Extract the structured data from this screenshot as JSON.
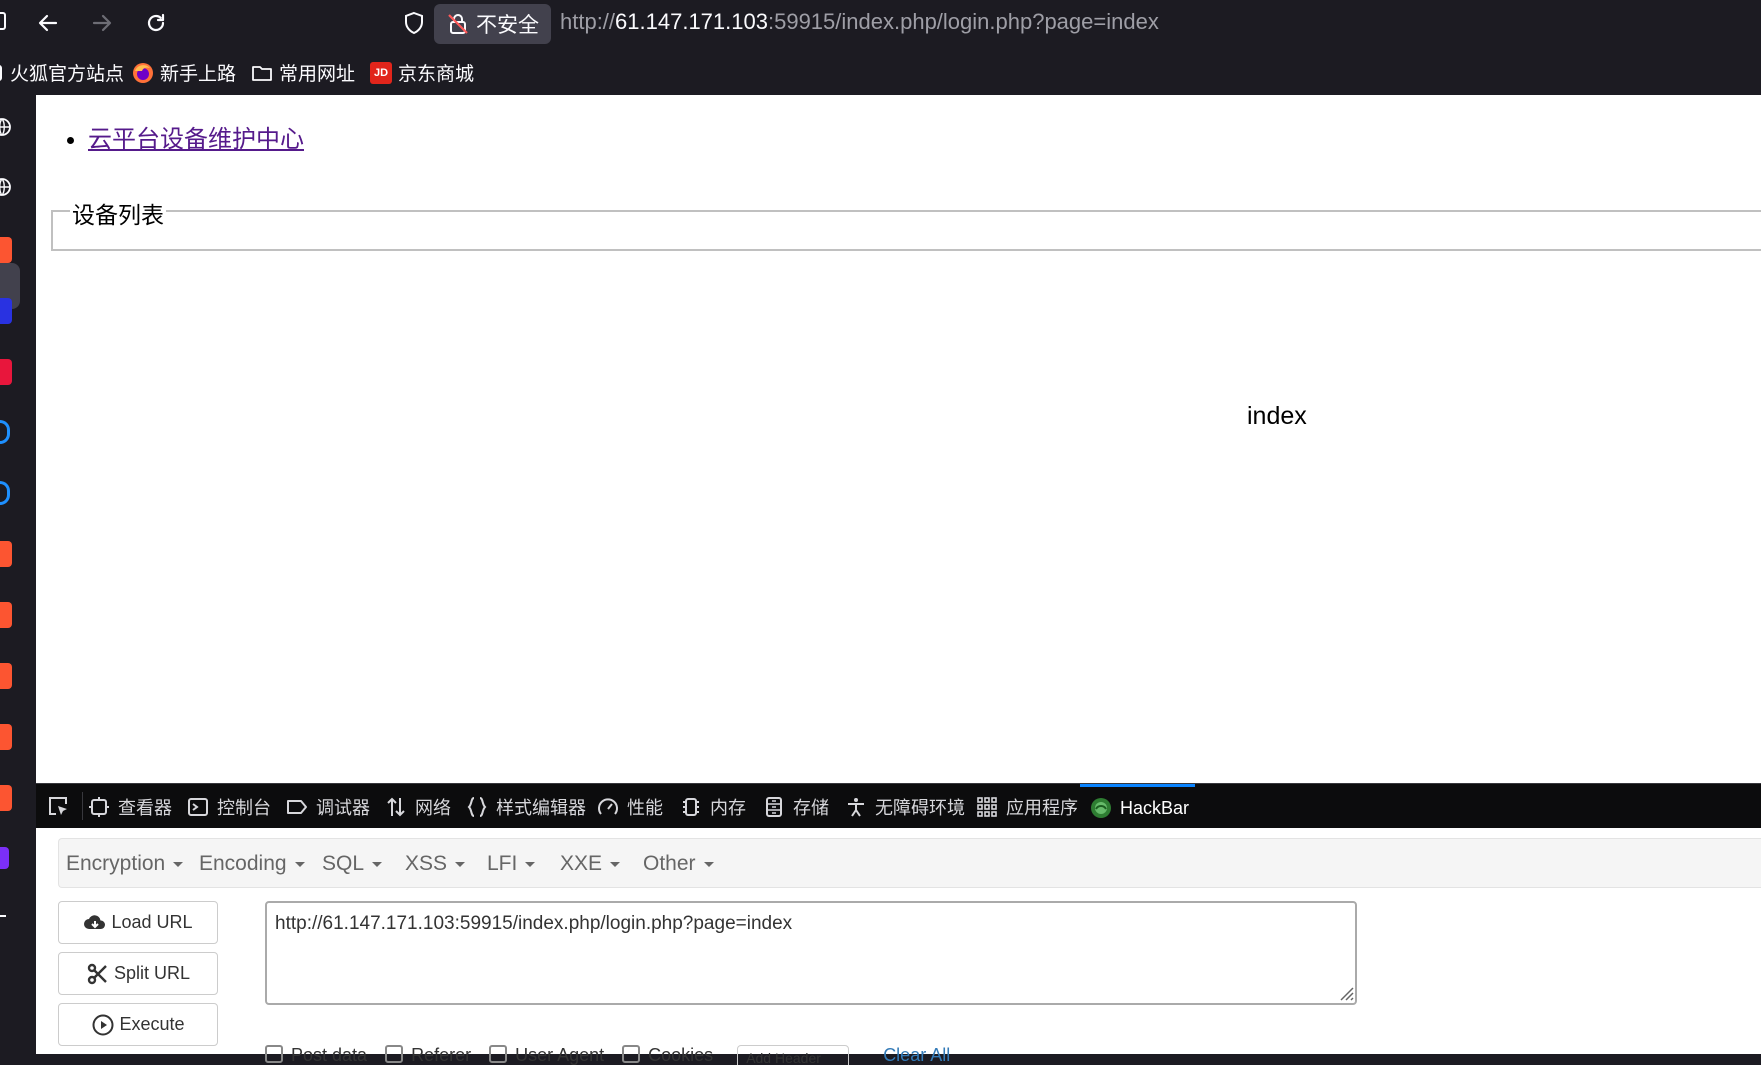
{
  "browser": {
    "nav_buttons": [
      "back-icon",
      "forward-icon",
      "reload-icon"
    ],
    "security_label": "不安全",
    "url_prefix": "http://",
    "url_host": "61.147.171.103",
    "url_rest": ":59915/index.php/login.php?page=index"
  },
  "bookmarks": [
    {
      "label": "火狐官方站点",
      "icon": "firefox-page-icon"
    },
    {
      "label": "新手上路",
      "icon": "firefox-icon"
    },
    {
      "label": "常用网址",
      "icon": "folder-icon"
    },
    {
      "label": "京东商城",
      "icon": "jd-icon",
      "icon_text": "JD"
    }
  ],
  "page": {
    "nav_link": "云平台设备维护中心",
    "fieldset_legend": "设备列表",
    "main_text": "index"
  },
  "devtools": {
    "tabs": [
      {
        "label": "查看器",
        "icon": "inspector-icon"
      },
      {
        "label": "控制台",
        "icon": "console-icon"
      },
      {
        "label": "调试器",
        "icon": "debugger-icon"
      },
      {
        "label": "网络",
        "icon": "network-icon"
      },
      {
        "label": "样式编辑器",
        "icon": "style-editor-icon"
      },
      {
        "label": "性能",
        "icon": "performance-icon"
      },
      {
        "label": "内存",
        "icon": "memory-icon"
      },
      {
        "label": "存储",
        "icon": "storage-icon"
      },
      {
        "label": "无障碍环境",
        "icon": "accessibility-icon"
      },
      {
        "label": "应用程序",
        "icon": "application-icon"
      },
      {
        "label": "HackBar",
        "icon": "hackbar-icon",
        "active": true
      }
    ]
  },
  "hackbar": {
    "menu": [
      "Encryption",
      "Encoding",
      "SQL",
      "XSS",
      "LFI",
      "XXE",
      "Other"
    ],
    "buttons": {
      "load": "Load URL",
      "split": "Split URL",
      "execute": "Execute"
    },
    "url_value": "http://61.147.171.103:59915/index.php/login.php?page=index",
    "checkboxes": [
      "Post data",
      "Referer",
      "User Agent",
      "Cookies"
    ],
    "add_header": "Add Header",
    "clear_all": "Clear All"
  },
  "colors": {
    "chrome_bg": "#1c1b22",
    "devtools_bg": "#0c0c0d",
    "link_visited": "#551a8b",
    "active_tab_accent": "#0a84ff"
  }
}
